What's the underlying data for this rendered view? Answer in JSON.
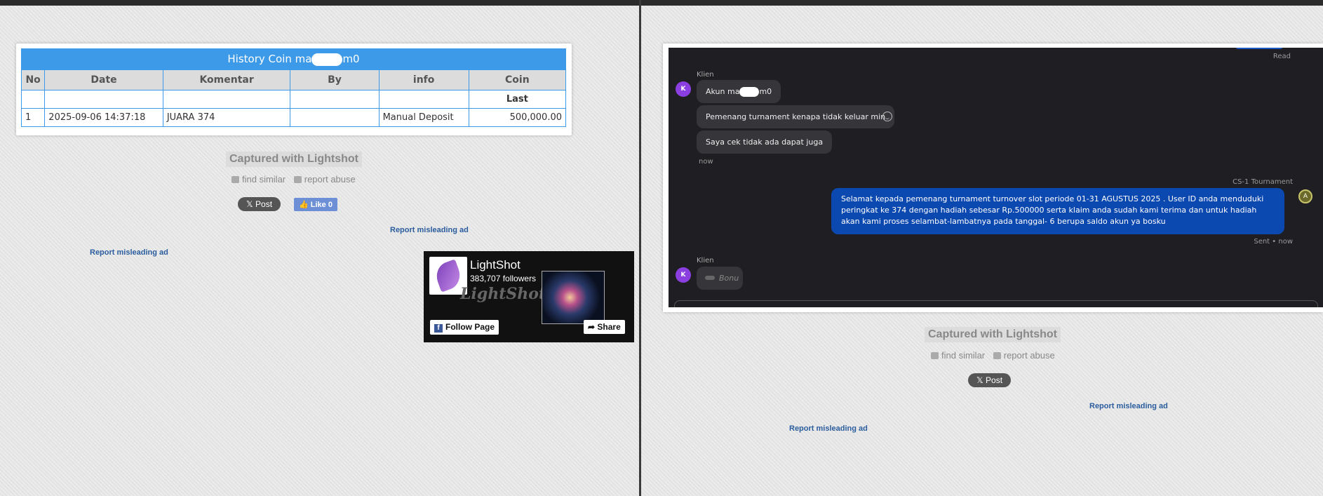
{
  "left": {
    "table": {
      "title_prefix": "History Coin ma",
      "title_suffix": "m0",
      "headers": [
        "No",
        "Date",
        "Komentar",
        "By",
        "info",
        "Coin"
      ],
      "subheader": "Last",
      "rows": [
        {
          "no": "1",
          "date": "2025-09-06 14:37:18",
          "komentar": "JUARA 374",
          "by": "",
          "info": "Manual Deposit",
          "coin": "500,000.00"
        }
      ]
    },
    "captured": "Captured with Lightshot",
    "find_similar": "find similar",
    "report_abuse": "report abuse",
    "post_label": "Post",
    "like_label": "Like 0",
    "report_ad_1": "Report misleading ad",
    "report_ad_2": "Report misleading ad",
    "fb": {
      "name": "LightShot",
      "followers": "383,707 followers",
      "watermark": "LightShot",
      "follow_label": "Follow Page",
      "share_label": "Share"
    }
  },
  "right": {
    "chat": {
      "read": "Read",
      "sender": "Klien",
      "avatar_letter": "K",
      "msg1_prefix": "Akun ma",
      "msg1_suffix": "m0",
      "msg2": "Pemenang turnament kenapa tidak keluar min",
      "msg3": "Saya cek tidak ada dapat juga",
      "time_now": "now",
      "agent_name": "CS-1 Tournament",
      "agent_msg": "Selamat kepada pemenang turnament turnover slot periode 01-31 AGUSTUS 2025 . User ID anda menduduki peringkat ke 374 dengan hadiah sebesar Rp.500000 serta klaim anda sudah kami terima dan untuk hadiah akan kami proses selambat-lambatnya pada tanggal- 6 berupa saldo akun ya bosku",
      "sent_status": "Sent • now",
      "sender2": "Klien",
      "typing_text": "Bonu"
    },
    "captured": "Captured with Lightshot",
    "find_similar": "find similar",
    "report_abuse": "report abuse",
    "post_label": "Post",
    "report_ad_1": "Report misleading ad",
    "report_ad_2": "Report misleading ad"
  }
}
